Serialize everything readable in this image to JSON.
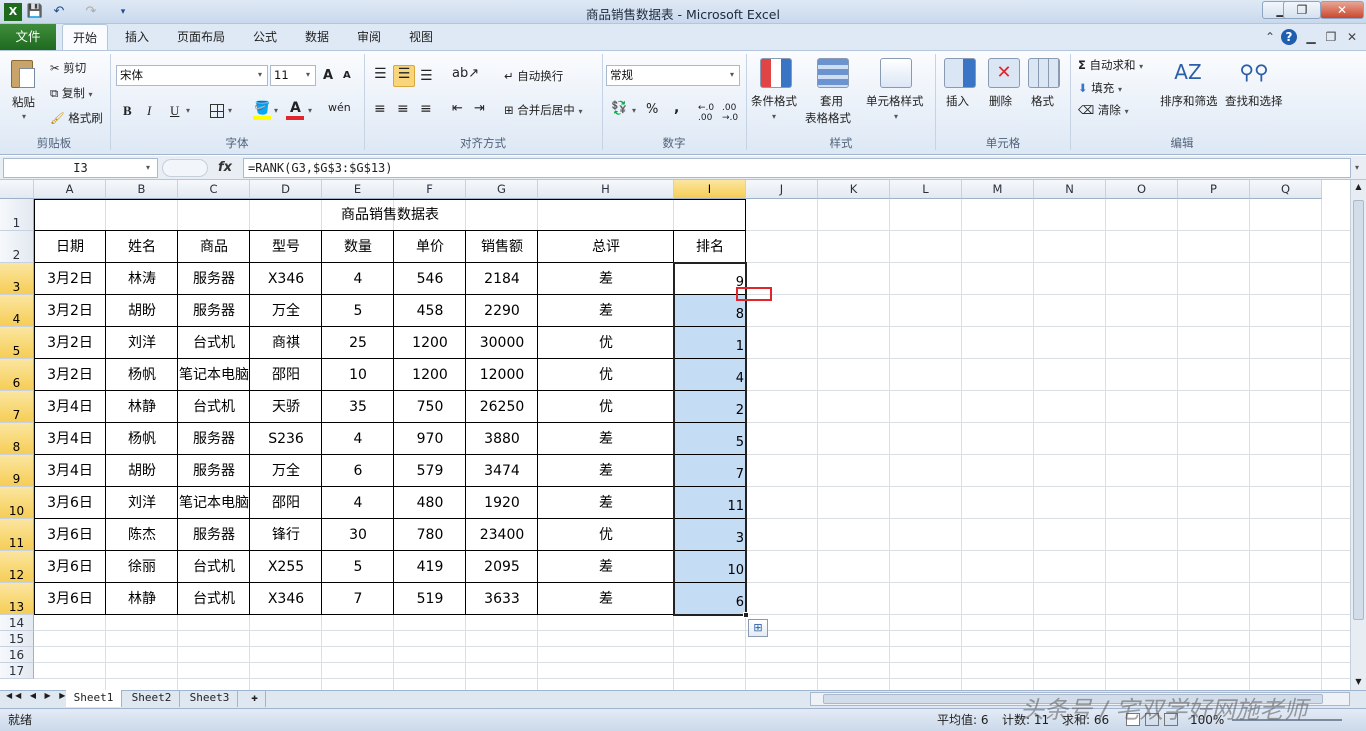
{
  "window": {
    "title": "商品销售数据表 - Microsoft Excel",
    "min": "▁",
    "max": "❐",
    "close": "✕"
  },
  "tabs": {
    "file": "文件",
    "items": [
      "开始",
      "插入",
      "页面布局",
      "公式",
      "数据",
      "审阅",
      "视图"
    ]
  },
  "ribbon": {
    "clipboard": {
      "paste": "粘贴",
      "cut": "剪切",
      "copy": "复制",
      "format_painter": "格式刷",
      "group": "剪贴板"
    },
    "font": {
      "name": "宋体",
      "size": "11",
      "grow": "A",
      "shrink": "A",
      "bold": "B",
      "italic": "I",
      "underline": "U",
      "wen": "wén",
      "group": "字体"
    },
    "alignment": {
      "wrap": "自动换行",
      "merge": "合并后居中",
      "group": "对齐方式"
    },
    "number": {
      "format": "常规",
      "percent": "%",
      "comma": ",",
      "group": "数字"
    },
    "styles": {
      "conditional": "条件格式",
      "table1": "套用",
      "table2": "表格格式",
      "cell_styles": "单元格样式",
      "group": "样式"
    },
    "cells": {
      "insert": "插入",
      "delete": "删除",
      "format": "格式",
      "group": "单元格"
    },
    "editing": {
      "autosum": "自动求和",
      "fill": "填充",
      "clear": "清除",
      "sort": "排序和筛选",
      "find": "查找和选择",
      "group": "编辑"
    }
  },
  "formula_bar": {
    "name_box": "I3",
    "fx": "fx",
    "formula": "=RANK(G3,$G$3:$G$13)"
  },
  "columns": [
    "A",
    "B",
    "C",
    "D",
    "E",
    "F",
    "G",
    "H",
    "I",
    "J",
    "K",
    "L",
    "M",
    "N",
    "O",
    "P",
    "Q"
  ],
  "rows": [
    "1",
    "2",
    "3",
    "4",
    "5",
    "6",
    "7",
    "8",
    "9",
    "10",
    "11",
    "12",
    "13",
    "14",
    "15",
    "16",
    "17"
  ],
  "table": {
    "title": "商品销售数据表",
    "headers": [
      "日期",
      "姓名",
      "商品",
      "型号",
      "数量",
      "单价",
      "销售额",
      "总评",
      "排名"
    ],
    "rows": [
      [
        "3月2日",
        "林涛",
        "服务器",
        "X346",
        "4",
        "546",
        "2184",
        "差",
        "9"
      ],
      [
        "3月2日",
        "胡盼",
        "服务器",
        "万全",
        "5",
        "458",
        "2290",
        "差",
        "8"
      ],
      [
        "3月2日",
        "刘洋",
        "台式机",
        "商祺",
        "25",
        "1200",
        "30000",
        "优",
        "1"
      ],
      [
        "3月2日",
        "杨帆",
        "笔记本电脑",
        "邵阳",
        "10",
        "1200",
        "12000",
        "优",
        "4"
      ],
      [
        "3月4日",
        "林静",
        "台式机",
        "天骄",
        "35",
        "750",
        "26250",
        "优",
        "2"
      ],
      [
        "3月4日",
        "杨帆",
        "服务器",
        "S236",
        "4",
        "970",
        "3880",
        "差",
        "5"
      ],
      [
        "3月4日",
        "胡盼",
        "服务器",
        "万全",
        "6",
        "579",
        "3474",
        "差",
        "7"
      ],
      [
        "3月6日",
        "刘洋",
        "笔记本电脑",
        "邵阳",
        "4",
        "480",
        "1920",
        "差",
        "11"
      ],
      [
        "3月6日",
        "陈杰",
        "服务器",
        "锋行",
        "30",
        "780",
        "23400",
        "优",
        "3"
      ],
      [
        "3月6日",
        "徐丽",
        "台式机",
        "X255",
        "5",
        "419",
        "2095",
        "差",
        "10"
      ],
      [
        "3月6日",
        "林静",
        "台式机",
        "X346",
        "7",
        "519",
        "3633",
        "差",
        "6"
      ]
    ]
  },
  "sheets": [
    "Sheet1",
    "Sheet2",
    "Sheet3"
  ],
  "status": {
    "ready": "就绪",
    "average": "平均值: 6",
    "count": "计数: 11",
    "sum": "求和: 66",
    "zoom": "100%"
  },
  "watermark": "头条号 / 宅双学好网施老师",
  "colors": {
    "selection": "#c5dcf5",
    "header_selected": "#f6cd55",
    "file_tab": "#2a7a2a",
    "annotation": "#e0262b"
  }
}
